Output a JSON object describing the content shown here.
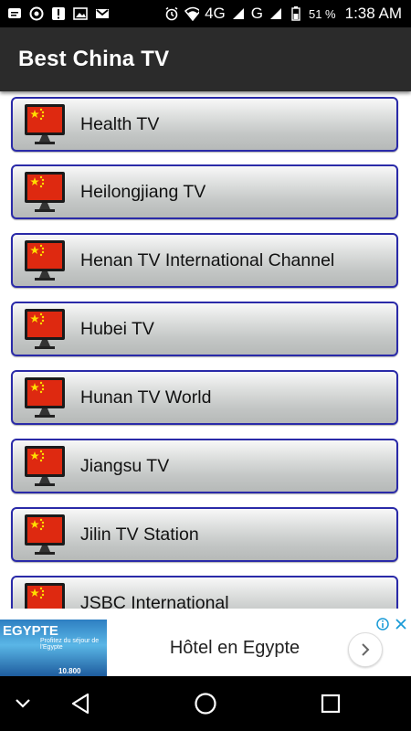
{
  "status_bar": {
    "network": "4G",
    "network2": "G",
    "battery": "51 %",
    "time": "1:38 AM"
  },
  "app_bar": {
    "title": "Best China TV"
  },
  "channels": [
    {
      "label": "Health TV"
    },
    {
      "label": "Heilongjiang TV"
    },
    {
      "label": "Henan TV International Channel"
    },
    {
      "label": "Hubei TV"
    },
    {
      "label": "Hunan TV World"
    },
    {
      "label": "Jiangsu TV"
    },
    {
      "label": "Jilin TV Station"
    },
    {
      "label": "JSBC International"
    }
  ],
  "ad": {
    "title": "Hôtel en Egypte",
    "image_text": "EGYPTE",
    "image_small": "Profitez du séjour de l'Egypte",
    "image_price": "10.800"
  },
  "colors": {
    "accent_border": "#2a2aa8",
    "app_bar": "#2b2b2b",
    "flag_red": "#de2910",
    "flag_star": "#ffde00"
  }
}
